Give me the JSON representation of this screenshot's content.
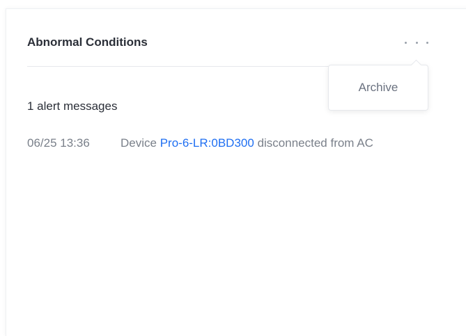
{
  "panel": {
    "title": "Abnormal Conditions",
    "more_icon": "more-horizontal-icon",
    "menu": {
      "items": [
        {
          "label": "Archive"
        }
      ]
    },
    "alert_count_text": "1 alert messages",
    "alerts": [
      {
        "time": "06/25 13:36",
        "prefix": "Device",
        "device": "Pro-6-LR:0BD300",
        "suffix": "disconnected from AC"
      }
    ]
  },
  "colors": {
    "link": "#1f6ff2",
    "title": "#2b2f38",
    "muted": "#7a808a"
  }
}
